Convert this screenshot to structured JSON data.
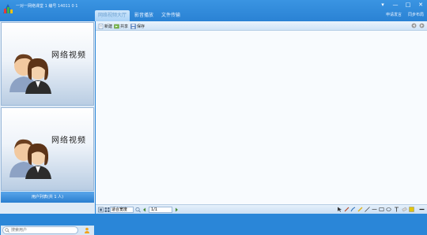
{
  "app": {
    "title": "一对一网络课堂 1 编号 14011 0 1"
  },
  "tabs": [
    {
      "label": "网络视频大厅",
      "active": true
    },
    {
      "label": "影音播放",
      "active": false
    },
    {
      "label": "文件传输",
      "active": false
    }
  ],
  "window_controls": {
    "menu": "▾",
    "minimize": "—",
    "maximize": "□",
    "close": "✕"
  },
  "right_links": {
    "apply_speak": "申请发言",
    "sync_layout": "同步布局"
  },
  "toolbar": {
    "new_label": "新建",
    "share_label": "共享",
    "save_label": "保存"
  },
  "video_panels": [
    {
      "label": "网络视频"
    },
    {
      "label": "网络视频"
    }
  ],
  "user_list": {
    "header": "用户列表(共 1 人)"
  },
  "search": {
    "placeholder": "搜索用户"
  },
  "bottom": {
    "zoom_value": "适合宽度",
    "page_value": "1/1"
  },
  "colors": {
    "accent": "#2a86d8",
    "sidebar_bg": "#dfeaf6",
    "canvas_bg": "#f8fbfe"
  }
}
